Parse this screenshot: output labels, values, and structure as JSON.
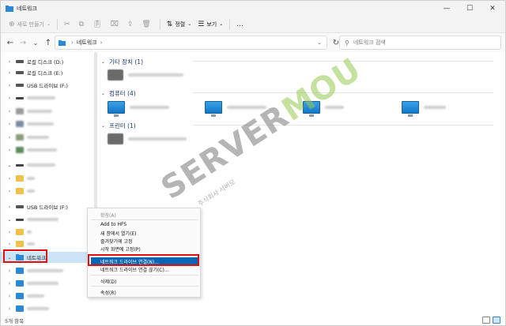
{
  "window": {
    "title": "네트워크",
    "controls": [
      "—",
      "☐",
      "✕"
    ]
  },
  "toolbar": {
    "new_label": "새로 만들기",
    "sort_label": "정렬",
    "view_label": "보기",
    "more_label": "..."
  },
  "address": {
    "crumb": "네트워크",
    "chevron": "›",
    "search_placeholder": "네트워크 검색"
  },
  "sidebar": {
    "drive_d": "로컬 디스크 (D:)",
    "drive_e": "로컬 디스크 (E:)",
    "drive_f": "USB 드라이브 (F:)",
    "drive_f2": "USB 드라이브 (F:)",
    "network": "네트워크"
  },
  "content": {
    "groups": [
      "기타 장치 (1)",
      "컴퓨터 (4)",
      "프린터 (1)"
    ]
  },
  "context_menu": {
    "items": [
      "확장(A)",
      "Add to HFS",
      "새 창에서 열기(E)",
      "즐겨찾기에 고정",
      "시작 화면에 고정(P)",
      "네트워크 드라이브 연결(N)...",
      "네트워크 드라이브 연결 끊기(C)...",
      "삭제(D)",
      "속성(R)"
    ],
    "highlighted_index": 5
  },
  "watermark": {
    "text_a": "SERVER",
    "text_b": "MOU",
    "sub": "주식회사 서버모"
  },
  "status": {
    "text": "5개 항목"
  },
  "colors": {
    "accent": "#0a64b4",
    "selection": "#cce4f7",
    "highlight_box": "#e01010"
  }
}
